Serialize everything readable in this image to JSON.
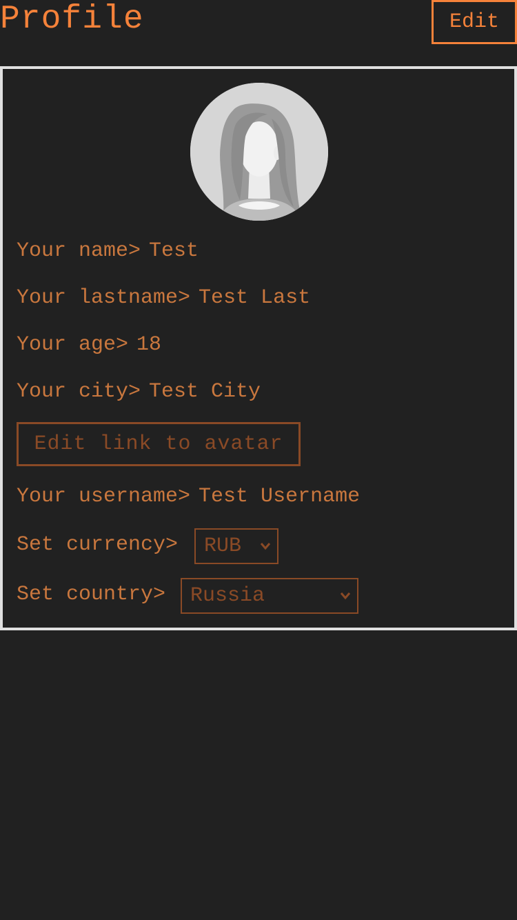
{
  "header": {
    "title": "Profile",
    "edit_label": "Edit"
  },
  "profile": {
    "avatar_icon": "female-avatar-placeholder",
    "name_label": "Your name>",
    "name_value": "Test",
    "lastname_label": "Your lastname>",
    "lastname_value": "Test Last",
    "age_label": "Your age>",
    "age_value": "18",
    "city_label": "Your city>",
    "city_value": "Test City",
    "avatar_link_button": "Edit link to avatar",
    "username_label": "Your username>",
    "username_value": "Test Username",
    "currency_label": "Set currency>",
    "currency_selected": "RUB",
    "country_label": "Set country>",
    "country_selected": "Russia"
  },
  "colors": {
    "background": "#212121",
    "accent": "#f5823a",
    "text": "#c9773e",
    "muted_border": "#8a4a26",
    "card_border": "#e0e0e0"
  }
}
